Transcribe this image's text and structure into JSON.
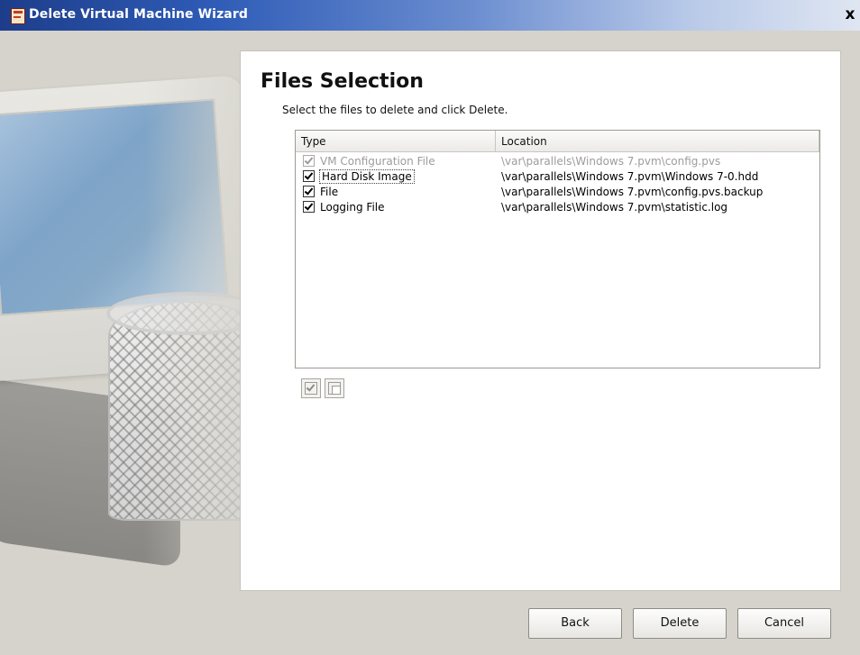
{
  "window": {
    "title": "Delete Virtual Machine Wizard",
    "close_glyph": "x",
    "icon": "wizard-icon"
  },
  "page": {
    "heading": "Files Selection",
    "instruction": "Select the files to delete and click Delete."
  },
  "files_table": {
    "columns": [
      "Type",
      "Location"
    ],
    "rows": [
      {
        "type": "VM Configuration File",
        "location": "\\var\\parallels\\Windows 7.pvm\\config.pvs",
        "checked": true,
        "disabled": true
      },
      {
        "type": "Hard Disk Image",
        "location": "\\var\\parallels\\Windows 7.pvm\\Windows 7-0.hdd",
        "checked": true,
        "disabled": false,
        "focused": true
      },
      {
        "type": "File",
        "location": "\\var\\parallels\\Windows 7.pvm\\config.pvs.backup",
        "checked": true,
        "disabled": false
      },
      {
        "type": "Logging File",
        "location": "\\var\\parallels\\Windows 7.pvm\\statistic.log",
        "checked": true,
        "disabled": false
      }
    ]
  },
  "toolbar": {
    "select_all_icon": "check-all-icon",
    "clear_all_icon": "uncheck-all-icon"
  },
  "buttons": {
    "back": "Back",
    "delete": "Delete",
    "cancel": "Cancel"
  }
}
